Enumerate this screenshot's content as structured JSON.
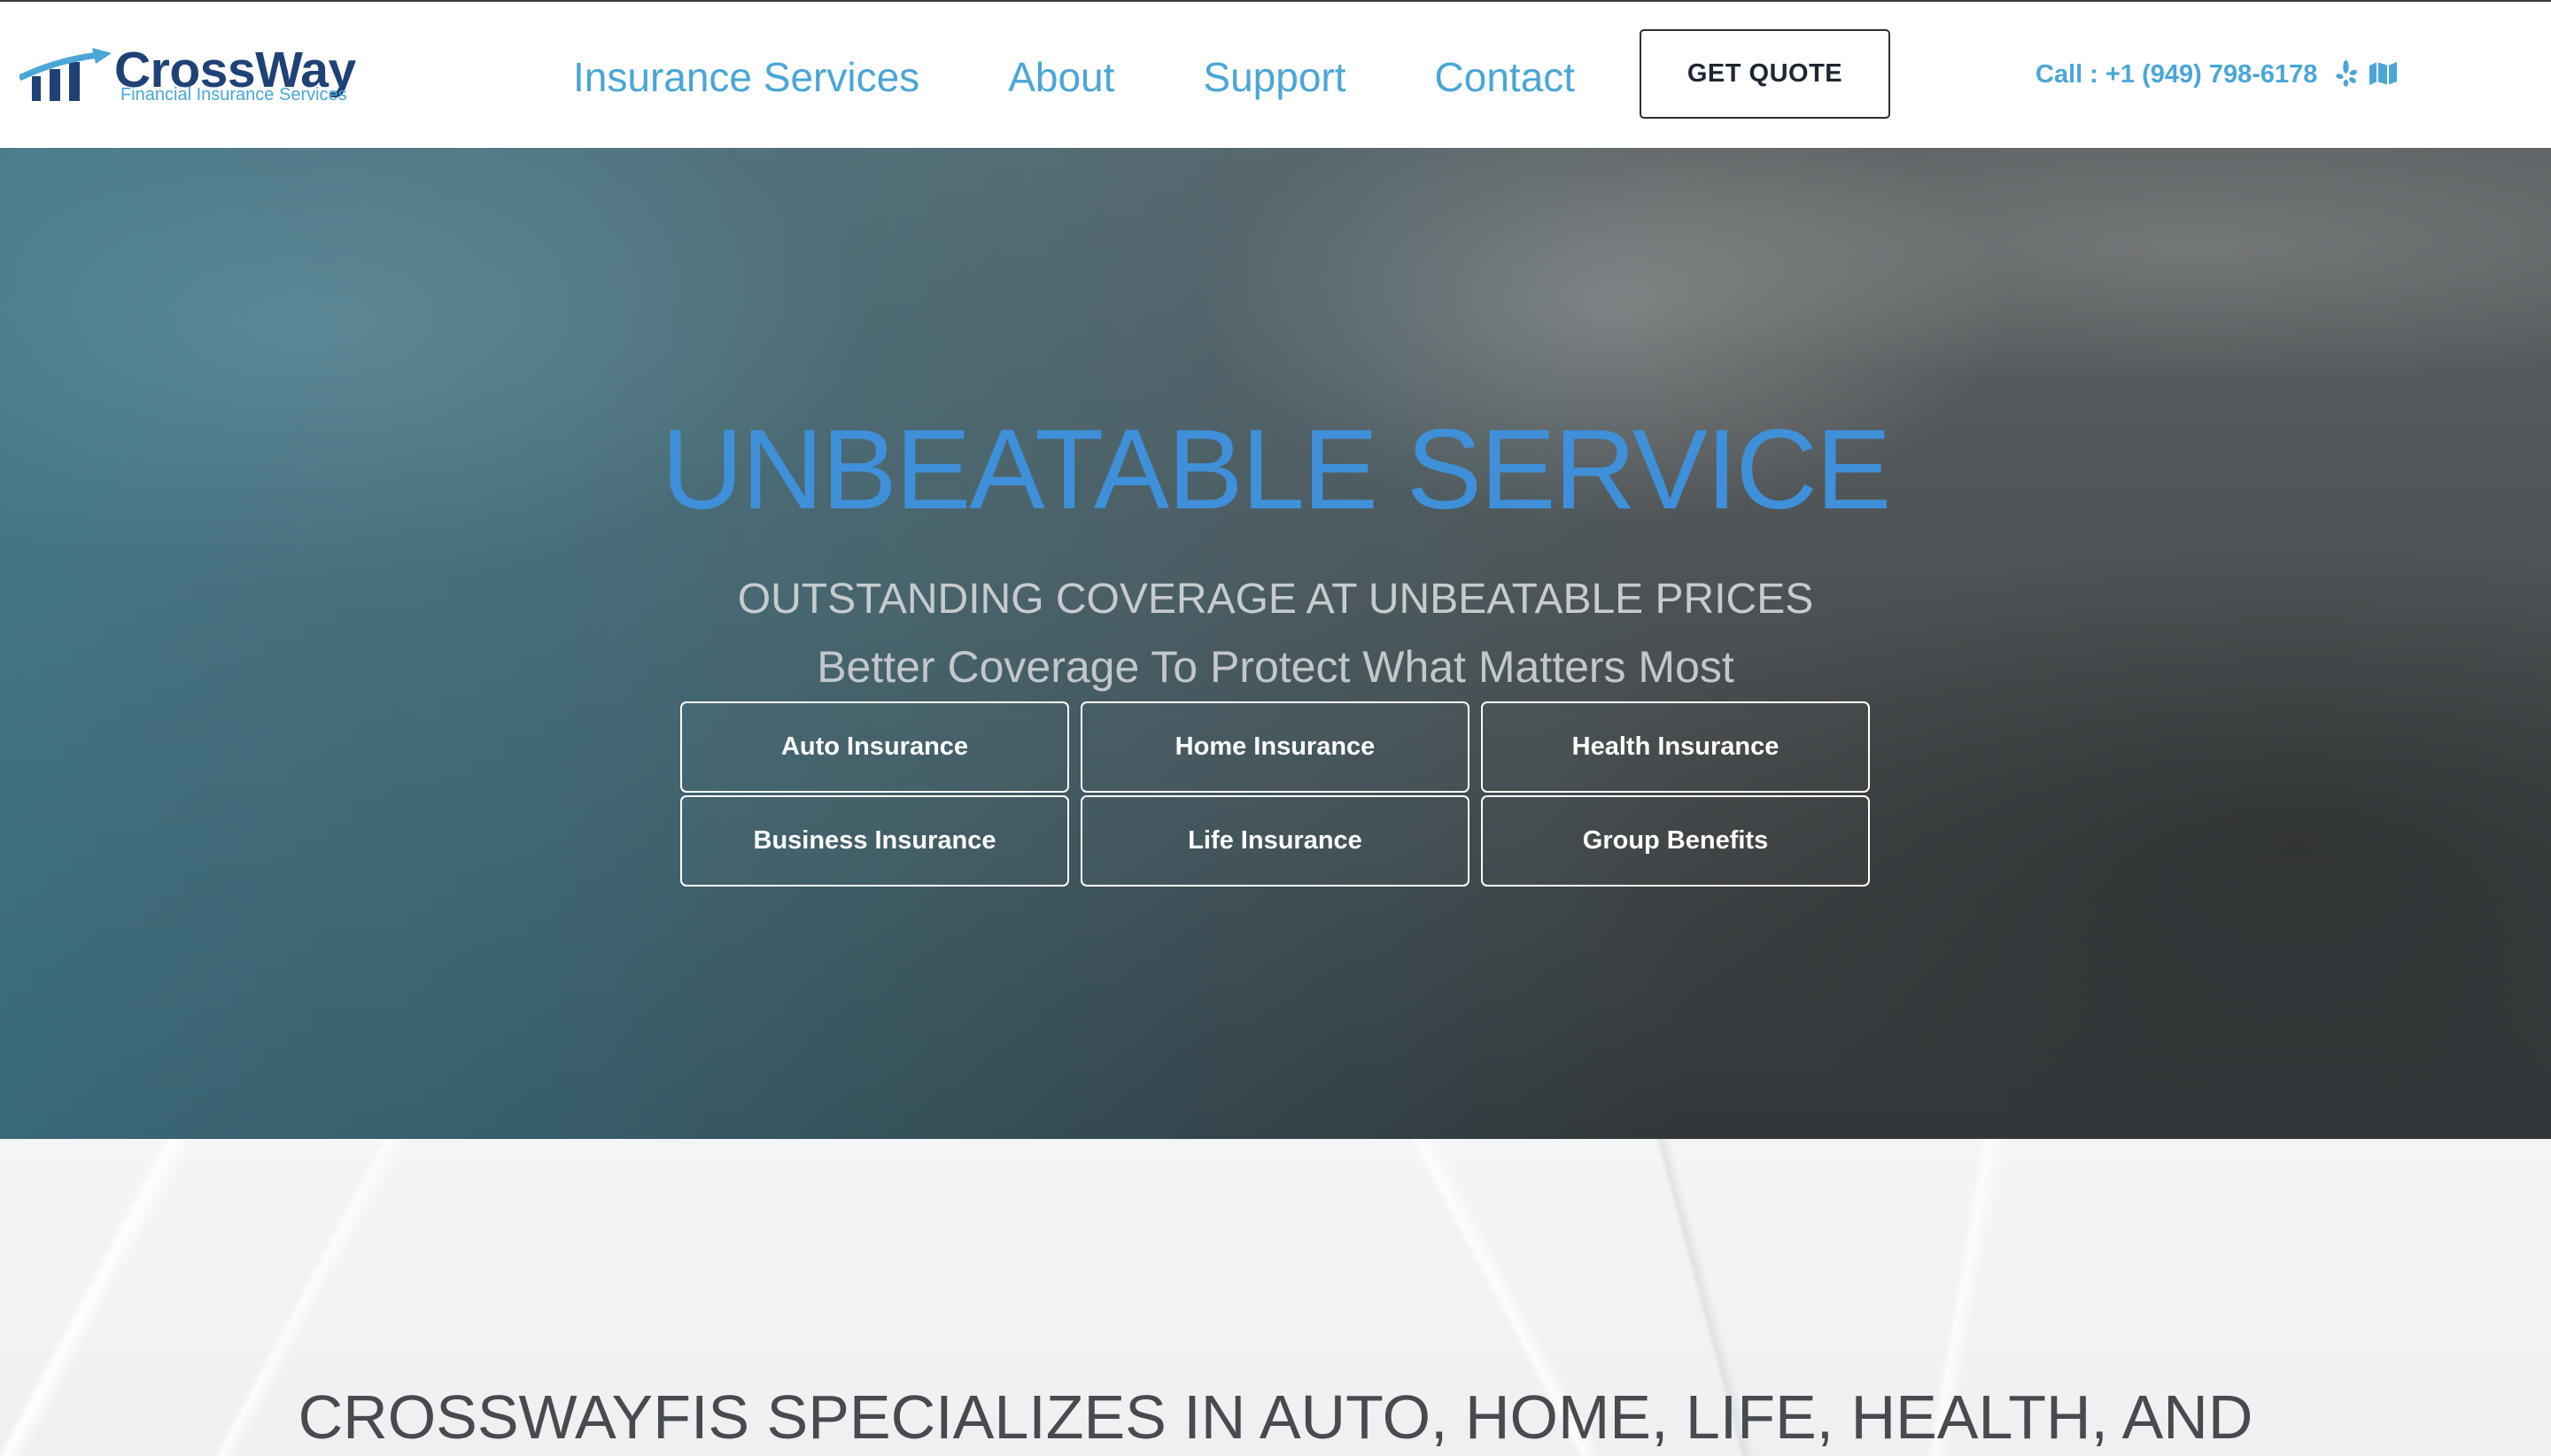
{
  "colors": {
    "accent": "#4aa6d8",
    "brand_navy": "#1f4276",
    "headline_blue": "#3f90d8",
    "cta_border": "#2c2f33",
    "hero_text_light": "#c7cbce",
    "intro_text": "#474a4f"
  },
  "header": {
    "logo": {
      "name": "CrossWay",
      "tagline": "Financial Insurance Services",
      "icon": "rising-bars-logo-icon"
    },
    "nav": [
      {
        "label": "Insurance Services"
      },
      {
        "label": "About"
      },
      {
        "label": "Support"
      },
      {
        "label": "Contact"
      }
    ],
    "cta": {
      "label": "GET QUOTE"
    },
    "call": {
      "text": "Call : +1 (949) 798-6178"
    },
    "social_icons": [
      "yelp-icon",
      "map-icon"
    ]
  },
  "hero": {
    "headline": "UNBEATABLE SERVICE",
    "subheadline": "OUTSTANDING COVERAGE AT UNBEATABLE PRICES",
    "tagline": "Better Coverage To Protect What Matters Most",
    "buttons": [
      {
        "label": "Auto Insurance"
      },
      {
        "label": "Home Insurance"
      },
      {
        "label": "Health Insurance"
      },
      {
        "label": "Business Insurance"
      },
      {
        "label": "Life Insurance"
      },
      {
        "label": "Group Benefits"
      }
    ]
  },
  "intro": {
    "heading": "CROSSWAYFIS SPECIALIZES IN AUTO, HOME, LIFE, HEALTH, AND"
  }
}
